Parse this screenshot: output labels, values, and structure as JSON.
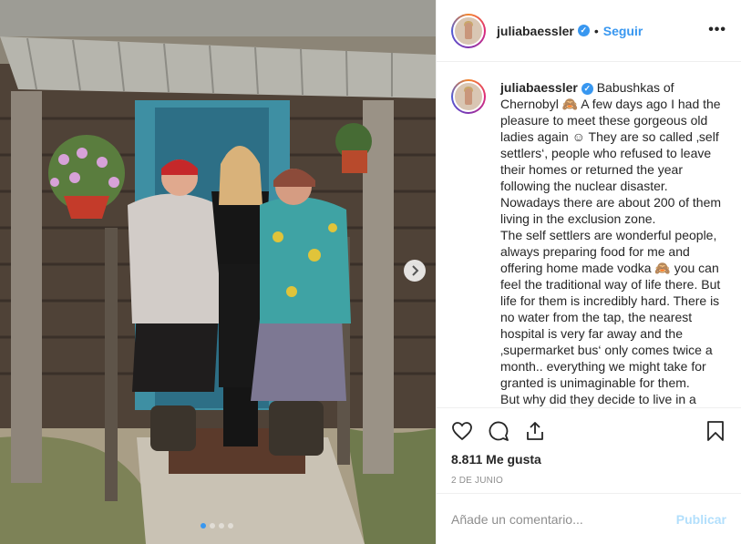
{
  "post": {
    "username": "juliabaessler",
    "follow_label": "Seguir",
    "separator": "•",
    "more_label": "•••",
    "caption_lines": [
      "Babushkas of Chernobyl 🙈 A few days ago I had the pleasure to meet these gorgeous old ladies again ☺ They are so called ‚self settlers‘, people who refused to leave their homes or returned the year following the nuclear disaster. Nowadays there are about 200 of them living in the exclusion zone.",
      "The self settlers are wonderful people, always preparing food for me and offering home made vodka 🙈 you can feel the traditional way of life there. But life for them is incredibly hard. There is no water from the tap, the nearest hospital is very far away and the ‚supermarket bus‘ only comes twice a month.. everything we might take for granted is unimaginable for them.",
      "But why did they decide to live in a"
    ],
    "likes": "8.811 Me gusta",
    "date": "2 DE JUNIO",
    "comment_placeholder": "Añade un comentario...",
    "publish_label": "Publicar",
    "carousel": {
      "count": 4,
      "active": 0
    }
  },
  "icons": {
    "verified": "verified-badge-icon",
    "like": "heart-icon",
    "comment": "comment-icon",
    "share": "share-icon",
    "save": "bookmark-icon",
    "next": "chevron-right-icon"
  },
  "colors": {
    "accent": "#3897f0",
    "publish_disabled": "#b2dffc",
    "muted": "#8e8e8e"
  }
}
